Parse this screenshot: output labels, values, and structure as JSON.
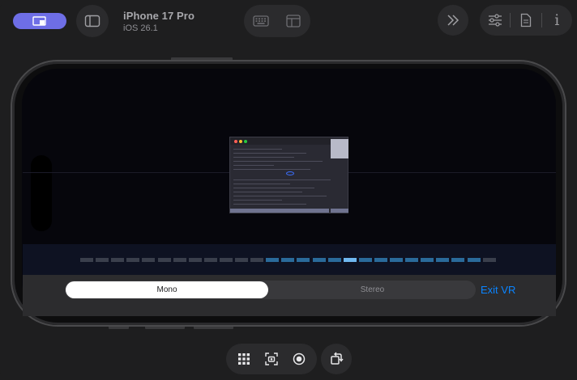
{
  "window": {
    "device_name": "iPhone 17 Pro",
    "os_version": "iOS 26.1"
  },
  "toolbar": {
    "home_icon": "person-screen-icon",
    "sidebar_icon": "sidebar-icon",
    "keyboard_icon": "keyboard-icon",
    "layout_icon": "layout-icon",
    "forward_icon": "chevron-forward-icon",
    "settings_icon": "sliders-icon",
    "document_icon": "document-icon",
    "info_label": "i"
  },
  "vr": {
    "mode_options": [
      "Mono",
      "Stereo"
    ],
    "selected_mode": "Mono",
    "exit_label": "Exit VR"
  },
  "bottom_toolbar": {
    "icons": [
      "grid-icon",
      "screenshot-icon",
      "record-icon",
      "rotate-icon"
    ]
  },
  "colors": {
    "accent": "#6e6ee6",
    "link": "#0a84ff",
    "timeline_active": "#2a6a9a",
    "timeline_highlight": "#6fb8f0",
    "timeline_inactive": "#3a3f4c"
  }
}
